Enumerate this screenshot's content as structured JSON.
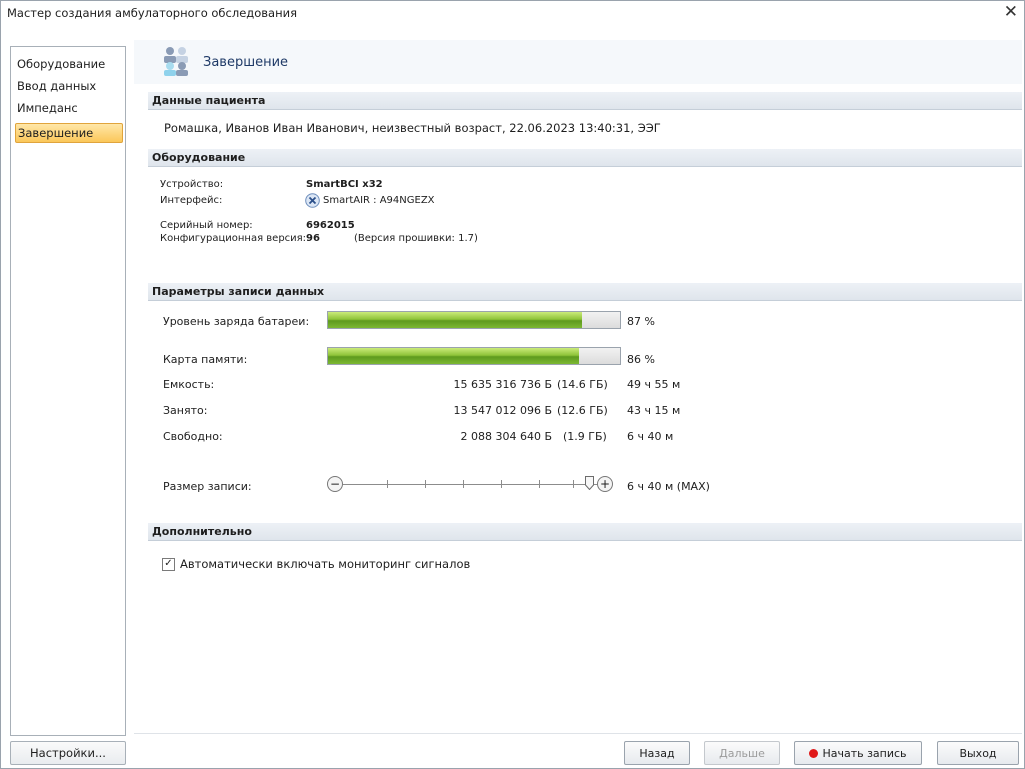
{
  "window": {
    "title": "Мастер создания амбулаторного обследования",
    "close_glyph": "✕"
  },
  "sidebar": {
    "items": [
      {
        "label": "Оборудование"
      },
      {
        "label": "Ввод данных"
      },
      {
        "label": "Импеданс"
      },
      {
        "label": "Завершение",
        "active": true
      }
    ],
    "settings_label": "Настройки..."
  },
  "page": {
    "title": "Завершение",
    "icon": "users-icon"
  },
  "patient": {
    "section_title": "Данные пациента",
    "summary": "Ромашка, Иванов Иван Иванович, неизвестный возраст, 22.06.2023 13:40:31, ЭЭГ"
  },
  "equipment": {
    "section_title": "Оборудование",
    "device_label": "Устройство:",
    "device_value": "SmartBCI x32",
    "interface_label": "Интерфейс:",
    "interface_value": "SmartAIR : A94NGEZX",
    "interface_icon": "wireless-icon",
    "serial_label": "Серийный номер:",
    "serial_value": "6962015",
    "config_label": "Конфигурационная версия:",
    "config_value": "96",
    "firmware_text": "(Версия прошивки: 1.7)"
  },
  "recording": {
    "section_title": "Параметры записи данных",
    "battery_label": "Уровень заряда батареи:",
    "battery_percent_value": 87,
    "battery_percent": "87 %",
    "memory_label": "Карта памяти:",
    "memory_percent_value": 86,
    "memory_percent": "86 %",
    "capacity_label": "Емкость:",
    "capacity_bytes": "15 635 316 736 Б",
    "capacity_gb": "(14.6 ГБ)",
    "capacity_time": "49 ч 55 м",
    "used_label": "Занято:",
    "used_bytes": "13 547 012 096 Б",
    "used_gb": "(12.6 ГБ)",
    "used_time": "43 ч 15 м",
    "free_label": "Свободно:",
    "free_bytes": "2 088 304 640 Б",
    "free_gb": "(1.9 ГБ)",
    "free_time": "6 ч 40 м",
    "size_label": "Размер записи:",
    "size_value": "6 ч 40 м (MAX)",
    "slider_position": 1.0,
    "minus_glyph": "−",
    "plus_glyph": "+"
  },
  "extra": {
    "section_title": "Дополнительно",
    "auto_monitoring_label": "Автоматически включать мониторинг сигналов",
    "auto_monitoring_checked": true,
    "check_glyph": "✓"
  },
  "footer": {
    "back_label": "Назад",
    "next_label": "Дальше",
    "record_label": "Начать запись",
    "exit_label": "Выход"
  },
  "colors": {
    "active_nav": "#fbc75a",
    "progress_fill": "#7cb833",
    "record_dot": "#e01919",
    "title_text": "#1f3a67"
  }
}
